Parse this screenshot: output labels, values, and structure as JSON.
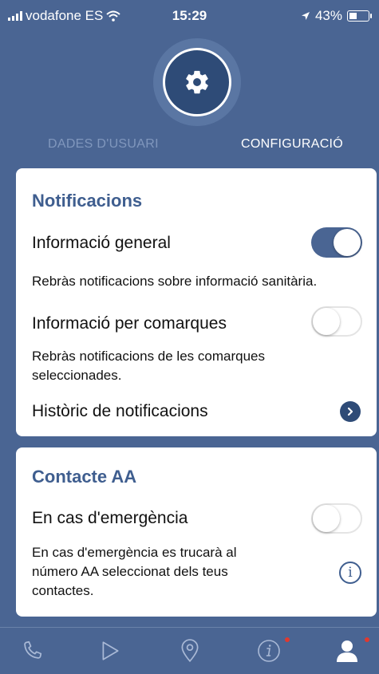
{
  "status_bar": {
    "carrier": "vodafone ES",
    "time": "15:29",
    "battery": "43%",
    "battery_level": 0.43
  },
  "profile_tabs": {
    "user_data": "DADES D'USUARI",
    "settings": "CONFIGURACIÓ"
  },
  "notifications_section": {
    "title": "Notificacions",
    "general_info": {
      "label": "Informació general",
      "enabled": true,
      "description": "Rebràs notificacions sobre informació sanitària."
    },
    "regional_info": {
      "label": "Informació per comarques",
      "enabled": false,
      "description_line1": "Rebràs notificacions de les comarques",
      "description_line2": "seleccionades."
    },
    "history": {
      "label": "Històric de notificacions"
    }
  },
  "contact_section": {
    "title": "Contacte AA",
    "emergency": {
      "label": "En cas d'emergència",
      "enabled": false,
      "description_line1": "En cas d'emergència es trucarà al",
      "description_line2": "número AA seleccionat dels teus",
      "description_line3": "contactes."
    }
  },
  "tab_bar": {
    "items": [
      {
        "icon": "phone-icon"
      },
      {
        "icon": "play-icon"
      },
      {
        "icon": "location-pin-icon"
      },
      {
        "icon": "info-icon",
        "badge": true
      },
      {
        "icon": "user-icon",
        "badge": true,
        "active": true
      }
    ]
  },
  "colors": {
    "primary": "#4a6593",
    "dark": "#2e4b77",
    "badge": "#e0392f"
  }
}
